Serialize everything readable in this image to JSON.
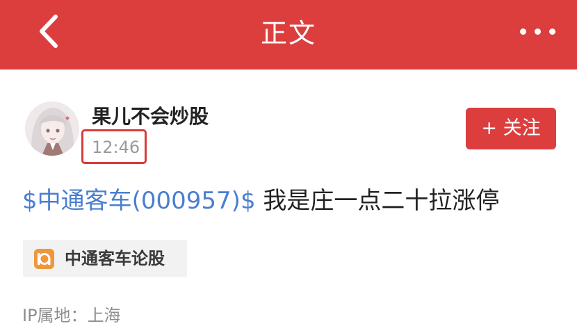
{
  "header": {
    "title": "正文",
    "back_icon": "chevron-left-icon",
    "more_icon": "more-horizontal-icon"
  },
  "author": {
    "name": "果儿不会炒股",
    "time": "12:46",
    "follow_label": "+ 关注"
  },
  "post": {
    "stock_link": "$中通客车(000957)$",
    "text": " 我是庄一点二十拉涨停"
  },
  "forum_tag": {
    "label": "中通客车论股",
    "icon": "forum-icon"
  },
  "location": {
    "label": "IP属地：",
    "value": "上海"
  },
  "colors": {
    "header_bg": "#dc3e3e",
    "link": "#4a7ed0",
    "highlight_box": "#d93a3a",
    "forum_icon": "#f0973a"
  }
}
